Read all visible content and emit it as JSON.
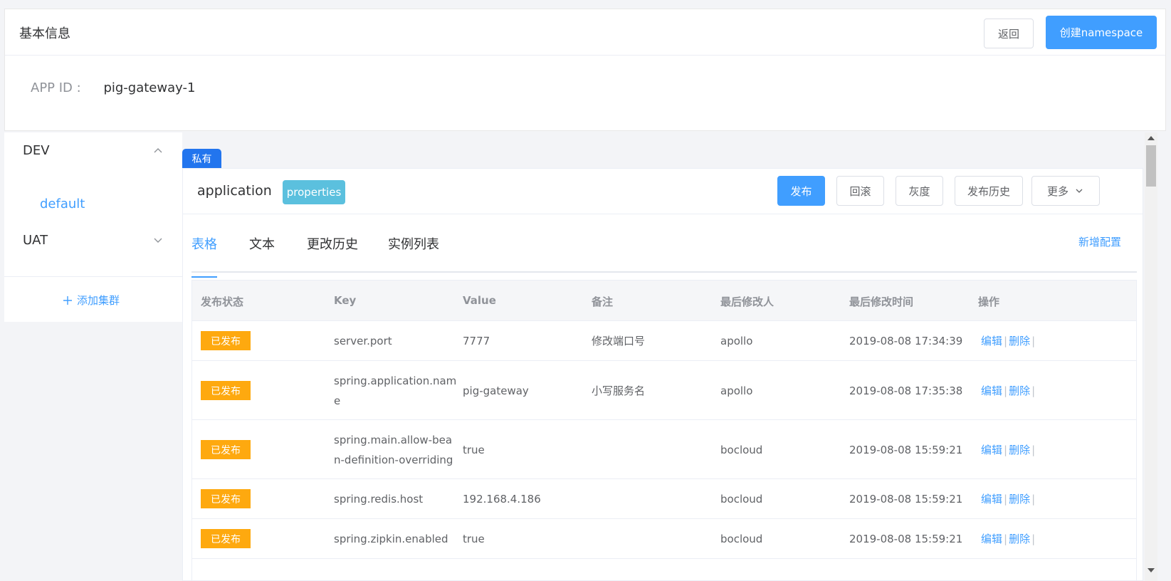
{
  "header": {
    "title": "基本信息",
    "back_label": "返回",
    "create_label": "创建namespace",
    "appid_label": "APP ID :",
    "appid_value": "pig-gateway-1"
  },
  "sidebar": {
    "envs": [
      {
        "label": "DEV",
        "expanded": true,
        "clusters": [
          "default"
        ]
      },
      {
        "label": "UAT",
        "expanded": false,
        "clusters": []
      }
    ],
    "add_cluster_label": "添加集群"
  },
  "namespace": {
    "tag": "私有",
    "name": "application",
    "format": "properties",
    "actions": {
      "publish": "发布",
      "rollback": "回滚",
      "gray": "灰度",
      "history": "发布历史",
      "more": "更多"
    },
    "tabs": [
      "表格",
      "文本",
      "更改历史",
      "实例列表"
    ],
    "active_tab": 0,
    "add_config_label": "新增配置"
  },
  "table": {
    "columns": [
      "发布状态",
      "Key",
      "Value",
      "备注",
      "最后修改人",
      "最后修改时间",
      "操作"
    ],
    "edit_label": "编辑",
    "delete_label": "删除",
    "rows": [
      {
        "status": "已发布",
        "key": "server.port",
        "key_lines": [
          "server.port"
        ],
        "value": "7777",
        "comment": "修改端口号",
        "modifier": "apollo",
        "time": "2019-08-08 17:34:39"
      },
      {
        "status": "已发布",
        "key": "spring.application.name",
        "key_lines": [
          "spring.application.nam",
          "e"
        ],
        "value": "pig-gateway",
        "comment": "小写服务名",
        "modifier": "apollo",
        "time": "2019-08-08 17:35:38"
      },
      {
        "status": "已发布",
        "key": "spring.main.allow-bean-definition-overriding",
        "key_lines": [
          "spring.main.allow-bea",
          "n-definition-overriding"
        ],
        "value": "true",
        "comment": "",
        "modifier": "bocloud",
        "time": "2019-08-08 15:59:21"
      },
      {
        "status": "已发布",
        "key": "spring.redis.host",
        "key_lines": [
          "spring.redis.host"
        ],
        "value": "192.168.4.186",
        "comment": "",
        "modifier": "bocloud",
        "time": "2019-08-08 15:59:21"
      },
      {
        "status": "已发布",
        "key": "spring.zipkin.enabled",
        "key_lines": [
          "spring.zipkin.enabled"
        ],
        "value": "true",
        "comment": "",
        "modifier": "bocloud",
        "time": "2019-08-08 15:59:21"
      }
    ]
  },
  "colors": {
    "primary": "#409eff",
    "private_tag": "#2275ee",
    "format_badge": "#5bc0de",
    "published_badge": "#fea90f"
  }
}
